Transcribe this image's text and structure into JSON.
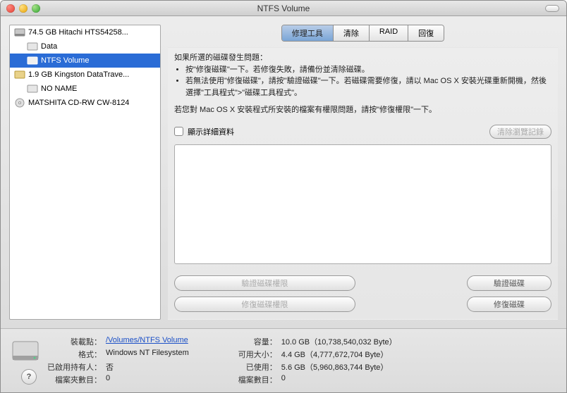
{
  "window": {
    "title": "NTFS Volume"
  },
  "sidebar": {
    "items": [
      {
        "label": "74.5 GB Hitachi HTS54258..."
      },
      {
        "label": "Data"
      },
      {
        "label": "NTFS Volume"
      },
      {
        "label": "1.9 GB Kingston DataTrave..."
      },
      {
        "label": "NO NAME"
      },
      {
        "label": "MATSHITA CD-RW CW-8124"
      }
    ]
  },
  "tabs": [
    "修理工具",
    "清除",
    "RAID",
    "回復"
  ],
  "panel": {
    "intro": "如果所選的磁碟發生問題：",
    "bullets": [
      "按\"修復磁碟\"一下。若修復失敗，請備份並清除磁碟。",
      "若無法使用\"修復磁碟\"，請按\"驗證磁碟\"一下。若磁碟需要修復，請以 Mac OS X 安裝光碟重新開機，然後選擇\"工具程式\">\"磁碟工具程式\"。"
    ],
    "note": "若您對 Mac OS X 安裝程式所安裝的檔案有權限問題，請按\"修復權限\"一下。",
    "show_details": "顯示詳細資料",
    "clear_history": "清除瀏覽記錄",
    "buttons": {
      "verify_permissions": "驗證磁碟權限",
      "repair_permissions": "修復磁碟權限",
      "verify_disk": "驗證磁碟",
      "repair_disk": "修復磁碟"
    }
  },
  "footer": {
    "left": [
      {
        "label": "裝載點：",
        "value": "/Volumes/NTFS Volume"
      },
      {
        "label": "格式：",
        "value": "Windows NT Filesystem"
      },
      {
        "label": "已啟用持有人：",
        "value": "否"
      },
      {
        "label": "檔案夾數目：",
        "value": "0"
      }
    ],
    "right": [
      {
        "label": "容量：",
        "value": "10.0 GB（10,738,540,032 Byte）"
      },
      {
        "label": "可用大小：",
        "value": "4.4 GB（4,777,672,704 Byte）"
      },
      {
        "label": "已使用：",
        "value": "5.6 GB（5,960,863,744 Byte）"
      },
      {
        "label": "檔案數目：",
        "value": "0"
      }
    ]
  }
}
